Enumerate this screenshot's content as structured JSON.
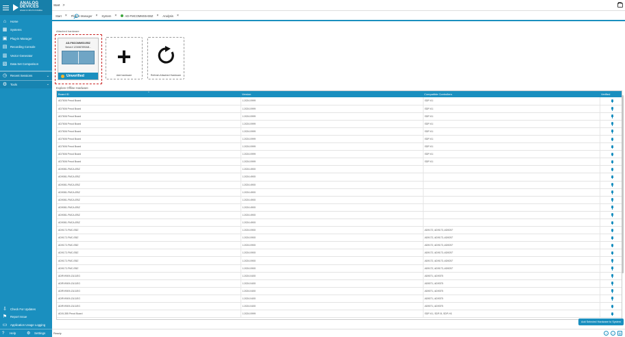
{
  "sidebar": {
    "logo_line1": "ANALOG",
    "logo_line2": "DEVICES",
    "logo_tag": "AHEAD OF WHAT'S POSSIBLE",
    "items": [
      {
        "label": "Home",
        "icon": "home-icon"
      },
      {
        "label": "Systems",
        "icon": "systems-icon"
      },
      {
        "label": "Plug-in Manager",
        "icon": "plugin-icon"
      },
      {
        "label": "Recording Console",
        "icon": "recording-icon"
      },
      {
        "label": "Vector Generator",
        "icon": "vector-icon"
      },
      {
        "label": "Data Set Comparison",
        "icon": "dataset-icon"
      }
    ],
    "groups": [
      {
        "label": "Recent Sessions",
        "icon": "recent-icon"
      },
      {
        "label": "Tools",
        "icon": "tools-icon"
      }
    ],
    "bottom_items": [
      {
        "label": "Check For Updates",
        "icon": "update-icon"
      },
      {
        "label": "Report Issue",
        "icon": "report-icon"
      },
      {
        "label": "Application Usage Logging",
        "icon": "logging-icon"
      }
    ],
    "help_label": "Help",
    "settings_label": "Settings"
  },
  "breadcrumb": {
    "start": "Start",
    "sep": ">"
  },
  "tabs": [
    {
      "label": "Start"
    },
    {
      "label": "Plug-in Manager"
    },
    {
      "label": "System"
    },
    {
      "label": "AD-FMCOMMS5-EBZ"
    },
    {
      "label": "Analysis"
    }
  ],
  "main": {
    "section_label": "Attached hardware",
    "device_card": {
      "title": "AD-FMCOMMS5-EBZ",
      "subtitle": "Serial # 1234567890AB...",
      "status": "Unverified"
    },
    "add_card": {
      "label": "Add hardware"
    },
    "refresh_card": {
      "label": "Refresh Attached Hardware"
    },
    "table_label": "Explore Offline Hardware",
    "columns": [
      "Board ID",
      "Version",
      "Compatible Controllers",
      "Verified"
    ],
    "rows": [
      [
        "AD7606 Pmod Board",
        "1.2024.0999",
        "SDP-K1"
      ],
      [
        "AD7606 Pmod Board",
        "1.2024.0999",
        "SDP-K1"
      ],
      [
        "AD7606 Pmod Board",
        "1.2024.0999",
        "SDP-K1"
      ],
      [
        "AD7606 Pmod Board",
        "1.2024.0999",
        "SDP-K1"
      ],
      [
        "AD7606 Pmod Board",
        "1.2024.0999",
        "SDP-K1"
      ],
      [
        "AD7606 Pmod Board",
        "1.2024.0999",
        "SDP-K1"
      ],
      [
        "AD7606 Pmod Board",
        "1.2024.0999",
        "SDP-K1"
      ],
      [
        "AD7606 Pmod Board",
        "1.2024.0999",
        "SDP-K1"
      ],
      [
        "AD7606 Pmod Board",
        "1.2024.0999",
        "SDP-K1"
      ],
      [
        "AD9081-FMCA-EBZ",
        "1.2024.4900",
        ""
      ],
      [
        "AD9081-FMCA-EBZ",
        "1.2024.4900",
        ""
      ],
      [
        "AD9081-FMCA-EBZ",
        "1.2024.4900",
        ""
      ],
      [
        "AD9081-FMCA-EBZ",
        "1.2024.4900",
        ""
      ],
      [
        "AD9081-FMCA-EBZ",
        "1.2024.4900",
        ""
      ],
      [
        "AD9081-FMCA-EBZ",
        "1.2024.4900",
        ""
      ],
      [
        "AD9081-FMCA-EBZ",
        "1.2024.4900",
        ""
      ],
      [
        "AD9081-FMCA-EBZ",
        "1.2024.4900",
        ""
      ],
      [
        "AD9172-FMC-EBZ",
        "1.2024.0900",
        "AD9172, AD9173, AD9207"
      ],
      [
        "AD9172-FMC-EBZ",
        "1.2024.0900",
        "AD9172, AD9173, AD9207"
      ],
      [
        "AD9172-FMC-EBZ",
        "1.2024.0900",
        "AD9172, AD9173, AD9207"
      ],
      [
        "AD9172-FMC-EBZ",
        "1.2024.0900",
        "AD9172, AD9173, AD9207"
      ],
      [
        "AD9172-FMC-EBZ",
        "1.2024.0900",
        "AD9172, AD9173, AD9207"
      ],
      [
        "AD9172-FMC-EBZ",
        "1.2024.0900",
        "AD9172, AD9173, AD9207"
      ],
      [
        "ADRV9009-ZU11EG",
        "1.2024.0400",
        "AD9371, AD9375"
      ],
      [
        "ADRV9009-ZU11EG",
        "1.2024.0400",
        "AD9371, AD9375"
      ],
      [
        "ADRV9009-ZU11EG",
        "1.2024.0400",
        "AD9371, AD9375"
      ],
      [
        "ADRV9009-ZU11EG",
        "1.2024.0400",
        "AD9371, AD9375"
      ],
      [
        "ADRV9009-ZU11EG",
        "1.2024.0400",
        "AD9371, AD9375"
      ],
      [
        "ADXL355 Pmod Board",
        "1.2024.0999",
        "SDP-K1, SDP-B, SDP-H1"
      ]
    ],
    "add_button": "Add Selected Hardware to System"
  },
  "status": {
    "text": "Ready"
  }
}
